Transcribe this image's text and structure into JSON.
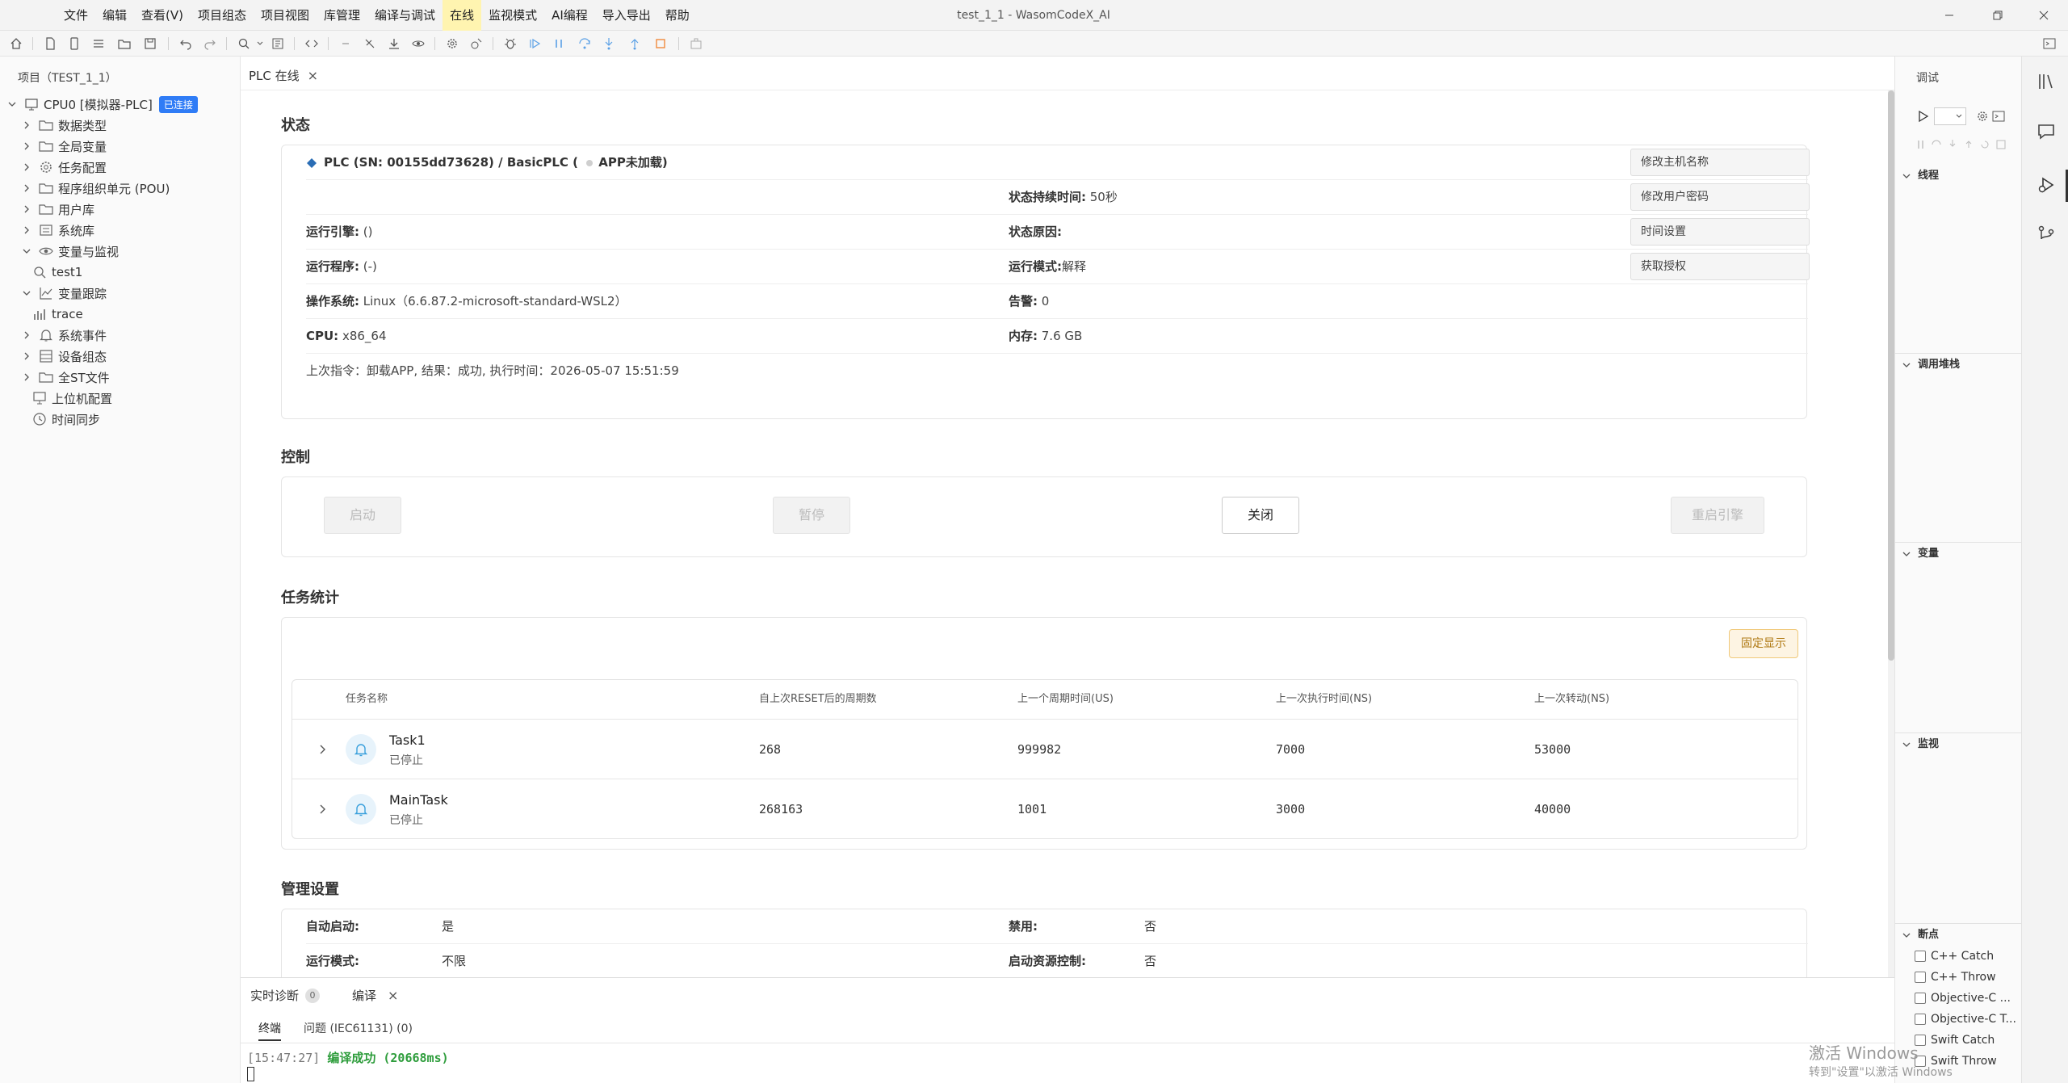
{
  "window": {
    "title": "test_1_1 - WasomCodeX_AI",
    "menus": [
      "文件",
      "编辑",
      "查看(V)",
      "项目组态",
      "项目视图",
      "库管理",
      "编译与调试",
      "在线",
      "监视模式",
      "AI编程",
      "导入导出",
      "帮助"
    ],
    "active_menu": "在线"
  },
  "project": {
    "title": "项目（TEST_1_1）",
    "root_label": "CPU0 [模拟器-PLC]",
    "root_badge": "已连接",
    "items": [
      {
        "label": "数据类型"
      },
      {
        "label": "全局变量"
      },
      {
        "label": "任务配置"
      },
      {
        "label": "程序组织单元 (POU)"
      },
      {
        "label": "用户库"
      },
      {
        "label": "系统库"
      },
      {
        "label": "变量与监视"
      },
      {
        "label": "test1"
      },
      {
        "label": "变量跟踪"
      },
      {
        "label": "trace"
      },
      {
        "label": "系统事件"
      },
      {
        "label": "设备组态"
      },
      {
        "label": "全ST文件"
      },
      {
        "label": "上位机配置"
      },
      {
        "label": "时间同步"
      }
    ]
  },
  "tab": {
    "label": "PLC 在线",
    "close": "×"
  },
  "status": {
    "section_title": "状态",
    "plc_line": "PLC (SN: 00155dd73628) / BasicPLC (",
    "app_state": "APP未加载)",
    "duration_label": "状态持续时间:",
    "duration_value": " 50秒",
    "engine_label": "运行引擎:",
    "engine_value": " ()",
    "reason_label": "状态原因:",
    "reason_value": "",
    "program_label": "运行程序:",
    "program_value": " (-)",
    "mode_label": "运行模式:",
    "mode_value": "解释",
    "os_label": "操作系统:",
    "os_value": " Linux（6.6.87.2-microsoft-standard-WSL2）",
    "alarm_label": "告警:",
    "alarm_value": " 0",
    "cpu_label": "CPU:",
    "cpu_value": " x86_64",
    "mem_label": "内存:",
    "mem_value": " 7.6 GB",
    "last_cmd": "上次指令：卸载APP, 结果：成功, 执行时间：2026-05-07 15:51:59",
    "buttons": [
      "修改主机名称",
      "修改用户密码",
      "时间设置",
      "获取授权"
    ]
  },
  "control": {
    "section_title": "控制",
    "start": "启动",
    "pause": "暂停",
    "close": "关闭",
    "restart": "重启引擎"
  },
  "tasks": {
    "section_title": "任务统计",
    "pin_label": "固定显示",
    "headers": [
      "任务名称",
      "自上次RESET后的周期数",
      "上一个周期时间(US)",
      "上一次执行时间(NS)",
      "上一次转动(NS)"
    ],
    "rows": [
      {
        "name": "Task1",
        "status": "已停止",
        "cycles": "268",
        "cycle_time": "999982",
        "exec_time": "7000",
        "jitter": "53000"
      },
      {
        "name": "MainTask",
        "status": "已停止",
        "cycles": "268163",
        "cycle_time": "1001",
        "exec_time": "3000",
        "jitter": "40000"
      }
    ]
  },
  "management": {
    "section_title": "管理设置",
    "rows": [
      {
        "l1": "自动启动:",
        "v1": "是",
        "l2": "禁用:",
        "v2": "否"
      },
      {
        "l1": "运行模式:",
        "v1": "不限",
        "l2": "启动资源控制:",
        "v2": "否"
      }
    ]
  },
  "bottom": {
    "tab_diag": "实时诊断",
    "diag_count": "0",
    "tab_compile": "编译",
    "close": "×",
    "sub_terminal": "终端",
    "sub_problems": "问题 (IEC61131) (0)",
    "console_time": "[15:47:27]",
    "console_msg": " 编译成功 (20668ms)"
  },
  "debug": {
    "title": "调试",
    "sections": [
      "线程",
      "调用堆栈",
      "变量",
      "监视",
      "断点"
    ],
    "breakpoints": [
      "C++ Catch",
      "C++ Throw",
      "Objective-C ...",
      "Objective-C T...",
      "Swift Catch",
      "Swift Throw"
    ]
  },
  "watermark": {
    "line1": "激活 Windows",
    "line2": "转到\"设置\"以激活 Windows"
  },
  "colors": {
    "accent": "#2f7cf6",
    "success": "#2e9d3c",
    "pin": "#b07a14"
  }
}
